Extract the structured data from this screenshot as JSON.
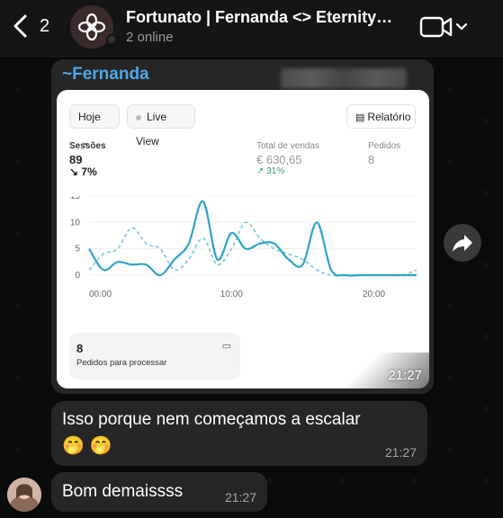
{
  "header": {
    "back_count": "2",
    "chat_title": "Fortunato | Fernanda <> Eternity…",
    "chat_subtitle": "2 online"
  },
  "image_message": {
    "sender": "~Fernanda",
    "time": "21:27",
    "shot": {
      "date_filter": "Hoje",
      "live_view": "Live View",
      "report_button": "Relatório",
      "sessions_label": "Sessões",
      "sessions_value": "89",
      "sessions_change": "↘ 7%",
      "sales_label": "Total de vendas",
      "sales_value": "€ 630,65",
      "sales_change": "↗ 31%",
      "orders_label": "Pedidos",
      "orders_value": "8",
      "pending_value": "8",
      "pending_label": "Pedidos para processar"
    }
  },
  "chart_data": {
    "type": "line",
    "x": [
      0,
      1,
      2,
      3,
      4,
      5,
      6,
      7,
      8,
      9,
      10,
      11,
      12,
      13,
      14,
      15,
      16,
      17,
      18,
      19,
      20,
      21,
      22,
      23
    ],
    "yticks": [
      "0",
      "5",
      "10",
      "15"
    ],
    "xticks": [
      {
        "label": "00:00",
        "x": 0
      },
      {
        "label": "10:00",
        "x": 10
      },
      {
        "label": "20:00",
        "x": 20
      }
    ],
    "ylim": [
      0,
      15
    ],
    "series": [
      {
        "style": "solid",
        "color": "#2ea3c8",
        "values": [
          5,
          1,
          2.5,
          2,
          2,
          0,
          3,
          6,
          14,
          3,
          8,
          5,
          6,
          6,
          3,
          2,
          10,
          1,
          0,
          0,
          0,
          0,
          0,
          0
        ]
      },
      {
        "style": "dashed",
        "color": "#7ac6e0",
        "values": [
          1,
          4,
          5,
          9,
          6,
          5,
          1,
          3,
          7,
          2,
          5,
          10,
          7,
          5,
          4,
          3,
          1,
          0,
          0,
          0,
          0,
          0,
          0,
          1
        ]
      }
    ]
  },
  "messages": [
    {
      "text": "Isso porque nem começamos a escalar",
      "emoji": "🤭 🤭",
      "time": "21:27"
    },
    {
      "text": "Bom demaissss",
      "time": "21:27"
    }
  ]
}
